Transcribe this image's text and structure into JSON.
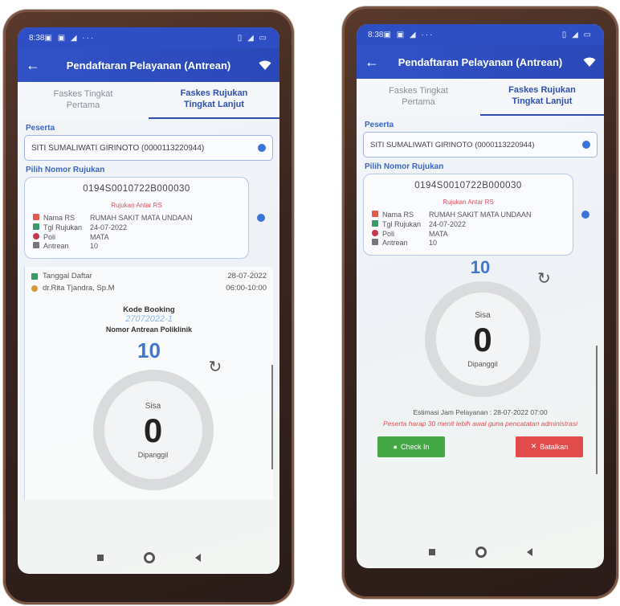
{
  "statusbar": {
    "time": "8:38",
    "icons": "▣ ▣ ◢ ···",
    "right_icons": "▯ ◢ ▭"
  },
  "appbar": {
    "title": "Pendaftaran Pelayanan (Antrean)"
  },
  "tabs": [
    {
      "line1": "Faskes Tingkat",
      "line2": "Pertama",
      "active": false
    },
    {
      "line1": "Faskes Rujukan",
      "line2": "Tingkat Lanjut",
      "active": true
    }
  ],
  "peserta": {
    "label": "Peserta",
    "value": "SITI SUMALIWATI GIRINOTO (0000113220944)"
  },
  "rujukan": {
    "label": "Pilih Nomor Rujukan",
    "number": "0194S0010722B000030",
    "type": "Rujukan Antar RS",
    "fields": [
      {
        "label": "Nama RS",
        "value": "RUMAH SAKIT MATA UNDAAN"
      },
      {
        "label": "Tgl Rujukan",
        "value": "24-07-2022"
      },
      {
        "label": "Poli",
        "value": "MATA"
      },
      {
        "label": "Antrean",
        "value": "10"
      }
    ]
  },
  "detail": {
    "tanggal_label": "Tanggal Daftar",
    "tanggal_value": "28-07-2022",
    "dokter": "dr.Rita Tjandra, Sp.M",
    "jam": "06:00-10:00",
    "kode_label": "Kode Booking",
    "kode_value": "27072022-1",
    "antrean_label": "Nomor Antrean Poliklinik",
    "antrean_number": "10"
  },
  "ring": {
    "sisa": "Sisa",
    "value": "0",
    "dipanggil": "Dipanggil"
  },
  "right": {
    "antrean_number": "10",
    "jam_text": "Estimasi Jam Pelayanan : 28-07-2022 07:00",
    "warning": "Peserta harap 30 menit lebih awal guna pencatatan administrasi",
    "checkin_label": "Check In",
    "batalkan_label": "Batalkan"
  },
  "colors": {
    "primary": "#2f4fb0",
    "accent_blue": "#3b74d8",
    "red": "#e24b4b",
    "green": "#43a845"
  },
  "icons": [
    "back-arrow-icon",
    "wifi-icon",
    "hospital-icon",
    "calendar-icon",
    "poli-icon",
    "queue-icon",
    "doctor-icon",
    "refresh-icon",
    "location-pin-icon",
    "close-icon"
  ]
}
